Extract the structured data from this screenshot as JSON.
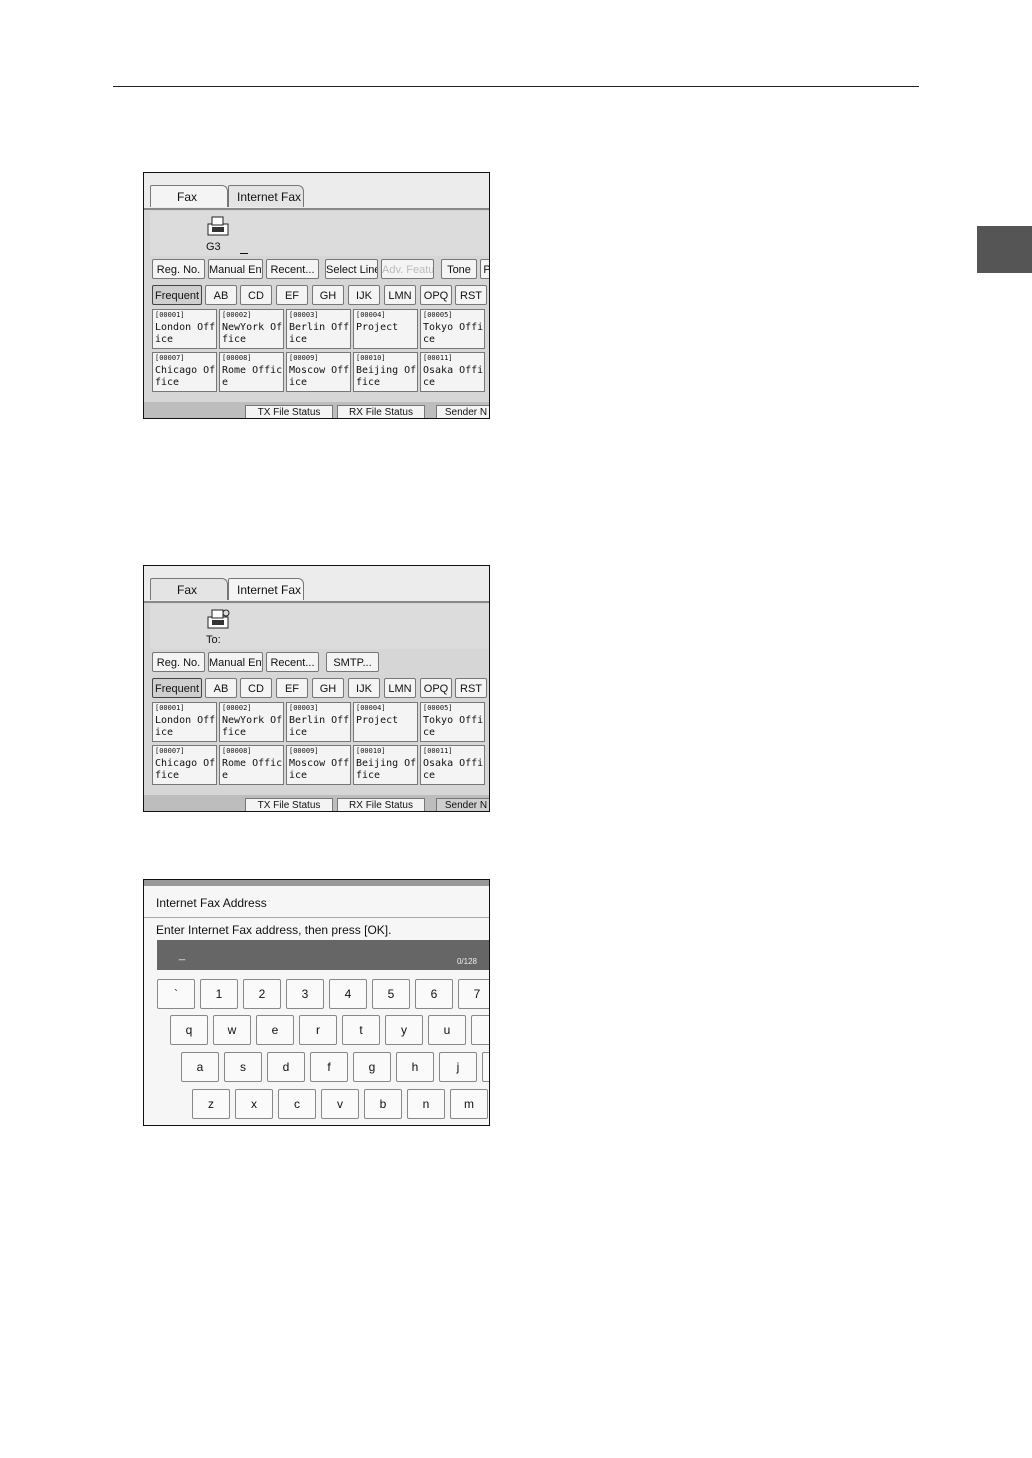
{
  "tabs": {
    "fax": "Fax",
    "internet_fax": "Internet Fax"
  },
  "screen1": {
    "mode_label": "G3",
    "buttons": [
      "Reg. No.",
      "Manual Entry",
      "Recent...",
      "Select Line",
      "Adv. Features",
      "Tone",
      "P"
    ],
    "index_tabs": [
      "Frequent",
      "AB",
      "CD",
      "EF",
      "GH",
      "IJK",
      "LMN",
      "OPQ",
      "RST"
    ],
    "destinations": [
      {
        "code": "[00001]",
        "name": "London Off\nice"
      },
      {
        "code": "[00002]",
        "name": "NewYork Of\nfice"
      },
      {
        "code": "[00003]",
        "name": "Berlin Off\nice"
      },
      {
        "code": "[00004]",
        "name": "Project"
      },
      {
        "code": "[00005]",
        "name": "Tokyo Offi\nce"
      },
      {
        "code": "[00007]",
        "name": "Chicago Of\nfice"
      },
      {
        "code": "[00008]",
        "name": "Rome Offic\ne"
      },
      {
        "code": "[00009]",
        "name": "Moscow Off\nice"
      },
      {
        "code": "[00010]",
        "name": "Beijing Of\nfice"
      },
      {
        "code": "[00011]",
        "name": "Osaka Offi\nce"
      }
    ],
    "status_buttons": [
      "TX File Status",
      "RX File Status",
      "Sender N"
    ]
  },
  "screen2": {
    "to_label": "To:",
    "buttons": [
      "Reg. No.",
      "Manual Entry",
      "Recent...",
      "SMTP..."
    ],
    "index_tabs": [
      "Frequent",
      "AB",
      "CD",
      "EF",
      "GH",
      "IJK",
      "LMN",
      "OPQ",
      "RST"
    ],
    "destinations": [
      {
        "code": "[00001]",
        "name": "London Off\nice"
      },
      {
        "code": "[00002]",
        "name": "NewYork Of\nfice"
      },
      {
        "code": "[00003]",
        "name": "Berlin Off\nice"
      },
      {
        "code": "[00004]",
        "name": "Project"
      },
      {
        "code": "[00005]",
        "name": "Tokyo Offi\nce"
      },
      {
        "code": "[00007]",
        "name": "Chicago Of\nfice"
      },
      {
        "code": "[00008]",
        "name": "Rome Offic\ne"
      },
      {
        "code": "[00009]",
        "name": "Moscow Off\nice"
      },
      {
        "code": "[00010]",
        "name": "Beijing Of\nfice"
      },
      {
        "code": "[00011]",
        "name": "Osaka Offi\nce"
      }
    ],
    "status_buttons": [
      "TX File Status",
      "RX File Status",
      "Sender N"
    ]
  },
  "screen3": {
    "title": "Internet Fax Address",
    "prompt": "Enter Internet Fax address, then press [OK].",
    "cursor": "_",
    "counter": "0/128",
    "keys_row1": [
      "`",
      "1",
      "2",
      "3",
      "4",
      "5",
      "6",
      "7"
    ],
    "keys_row2": [
      "q",
      "w",
      "e",
      "r",
      "t",
      "y",
      "u",
      ""
    ],
    "keys_row3": [
      "a",
      "s",
      "d",
      "f",
      "g",
      "h",
      "j",
      ""
    ],
    "keys_row4": [
      "z",
      "x",
      "c",
      "v",
      "b",
      "n",
      "m"
    ]
  }
}
